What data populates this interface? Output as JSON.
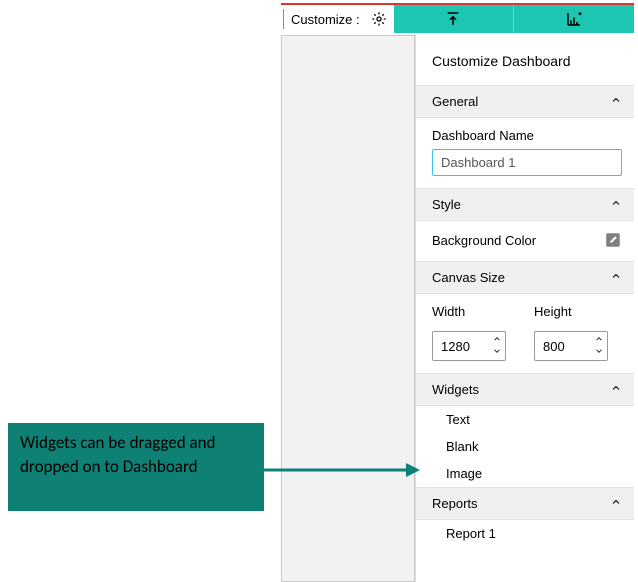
{
  "topbar": {
    "customize_label": "Customize :"
  },
  "panel": {
    "title": "Customize Dashboard",
    "general": {
      "header": "General",
      "dashboard_name_label": "Dashboard Name",
      "dashboard_name_value": "Dashboard 1"
    },
    "style": {
      "header": "Style",
      "bg_color_label": "Background Color"
    },
    "canvas_size": {
      "header": "Canvas Size",
      "width_label": "Width",
      "width_value": "1280",
      "height_label": "Height",
      "height_value": "800"
    },
    "widgets": {
      "header": "Widgets",
      "items": [
        "Text",
        "Blank",
        "Image"
      ]
    },
    "reports": {
      "header": "Reports",
      "items": [
        "Report 1"
      ]
    }
  },
  "annotation": {
    "text": "Widgets can be dragged and dropped on to Dashboard"
  }
}
